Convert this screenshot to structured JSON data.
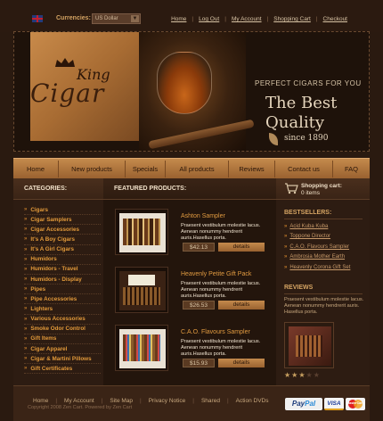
{
  "topbar": {
    "currencies_label": "Currencies:",
    "currency_selected": "US Dollar",
    "links": [
      "Home",
      "Log Out",
      "My Account",
      "Shopping Cart",
      "Checkout"
    ]
  },
  "banner": {
    "logo_top": "King",
    "logo_main": "Cigar",
    "tagline": "PERFECT CIGARS FOR YOU",
    "headline_1": "The Best",
    "headline_2": "Quality",
    "since": "since 1890"
  },
  "nav": {
    "items": [
      "Home",
      "New products",
      "Specials",
      "All products",
      "Reviews",
      "Contact us",
      "FAQ"
    ]
  },
  "categories": {
    "heading": "CATEGORIES:",
    "items": [
      "Cigars",
      "Cigar Samplers",
      "Cigar Accessories",
      "It's A Boy Cigars",
      "It's A Girl Cigars",
      "Humidors",
      "Humidors - Travel",
      "Humidors - Display",
      "Pipes",
      "Pipe Accessories",
      "Lighters",
      "Various Accessories",
      "Smoke Odor Control",
      "Gift Items",
      "Cigar Apparel",
      "Cigar & Martini Pillows",
      "Gift Certificates"
    ]
  },
  "featured": {
    "heading": "FEATURED PRODUCTS:",
    "details_label": "details",
    "products": [
      {
        "title": "Ashton Sampler",
        "desc": "Praesent vestibulum molestie lacus. Aenean nonummy hendrerit auris.Hasellus porta.",
        "price": "$42.13"
      },
      {
        "title": "Heavenly Petite Gift Pack",
        "desc": "Praesent vestibulum molestie lacus. Aenean nonummy hendrerit auris.Hasellus porta.",
        "price": "$26.53"
      },
      {
        "title": "C.A.O. Flavours Sampler",
        "desc": "Praesent vestibulum molestie lacus. Aenean nonummy hendrerit auris.Hasellus porta.",
        "price": "$15.93"
      }
    ]
  },
  "cart": {
    "title": "Shopping cart:",
    "items": "0 items"
  },
  "bestsellers": {
    "heading": "BESTSELLERS:",
    "items": [
      "Acid Kuba Kuba",
      "Toppone Director",
      "C.A.O. Flavours Sampler",
      "Ambrosia Mother Earth",
      "Heavenly Corona Gift Set"
    ]
  },
  "reviews": {
    "heading": "REVIEWS",
    "text": "Praesent vestibulum molestie lacus. Aenean nonummy hendrerit auris. Hasellus porta.",
    "rating": 3,
    "max_rating": 5
  },
  "footer": {
    "links": [
      "Home",
      "My Account",
      "Site Map",
      "Privacy Notice",
      "Shared",
      "Action DVDs"
    ],
    "copyright": "Copyright 2008 Zen Cart. Powered by Zen Cart",
    "paypal_1": "Pay",
    "paypal_2": "Pal",
    "visa": "VISA",
    "mastercard": "MasterCard"
  },
  "colors": {
    "background": "#2a1a10",
    "accent": "#c48a4c",
    "link_orange": "#e39a3a"
  }
}
